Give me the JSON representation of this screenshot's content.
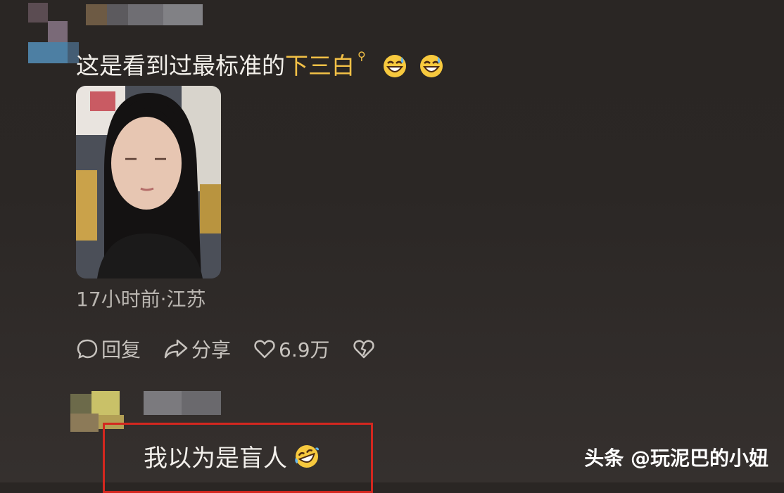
{
  "comment": {
    "text_before": "这是看到过最标准的",
    "highlight": "下三白",
    "emojis": [
      "grin-sweat-emoji",
      "grin-sweat-emoji"
    ],
    "meta": "17小时前·江苏"
  },
  "actions": {
    "reply_label": "回复",
    "share_label": "分享",
    "like_count": "6.9万"
  },
  "reply": {
    "text": "我以为是盲人",
    "emoji": "rofl-emoji"
  },
  "watermark": {
    "text": "头条 @玩泥巴的小妞"
  },
  "colors": {
    "background": "#2b2725",
    "highlight": "#f2c046",
    "box_border": "#d3271f"
  }
}
